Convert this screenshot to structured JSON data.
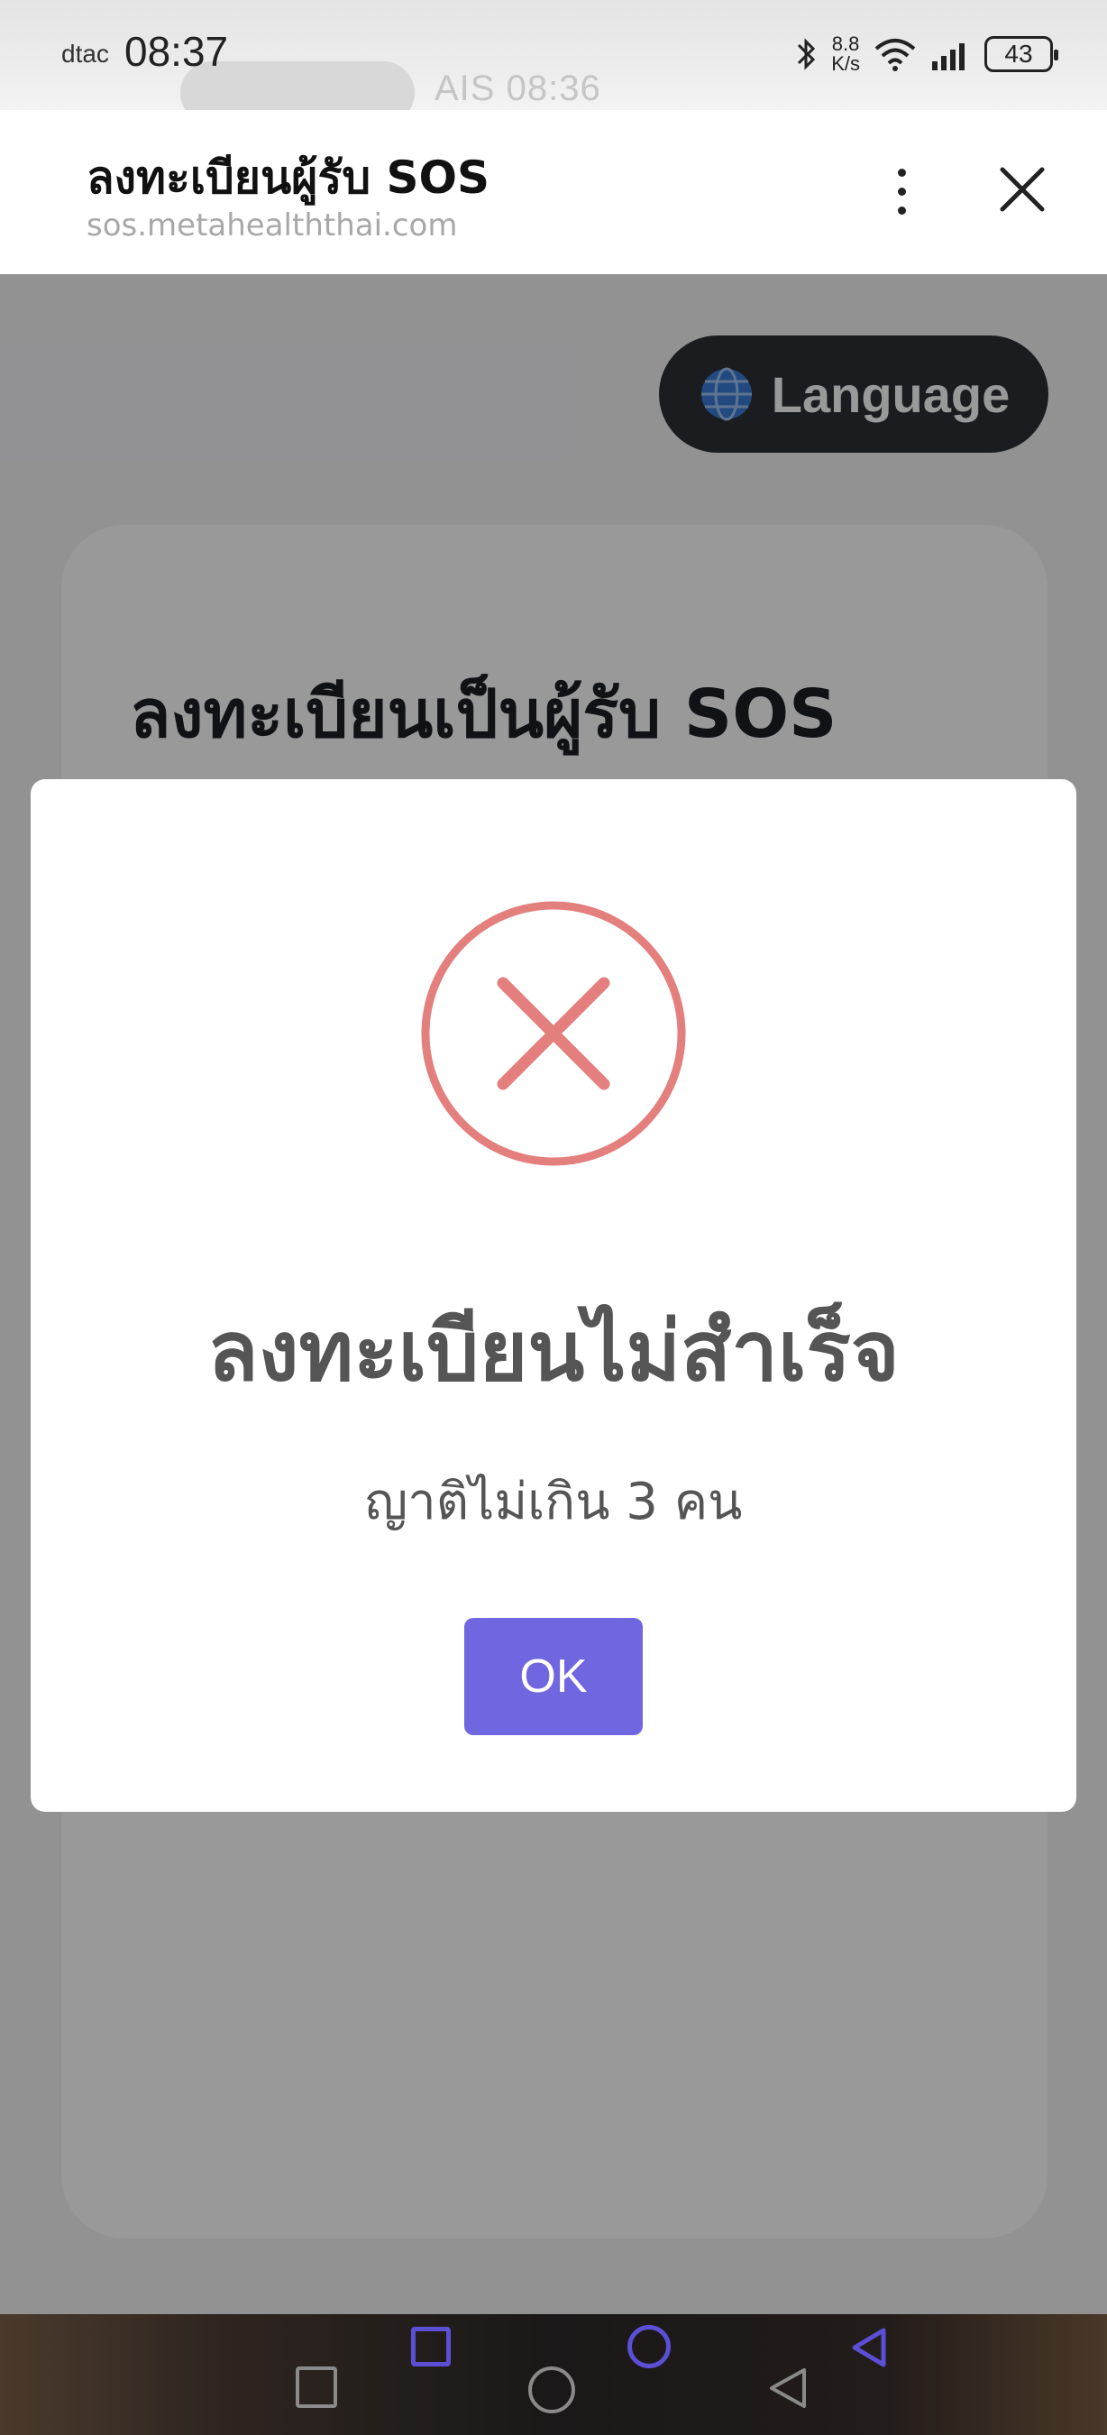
{
  "status_bar": {
    "carrier": "dtac",
    "time": "08:37",
    "ghost_carrier_time": "AIS 08:36",
    "net_speed_value": "8.8",
    "net_speed_unit": "K/s",
    "battery": "43"
  },
  "browser": {
    "title": "ลงทะเบียนผู้รับ SOS",
    "url": "sos.metahealththai.com",
    "menu_icon": "more-vert-icon",
    "close_icon": "close-icon"
  },
  "page": {
    "language_button": "Language",
    "form_title": "ลงทะเบียนเป็นผู้รับ SOS"
  },
  "modal": {
    "icon": "error-x-icon",
    "title": "ลงทะเบียนไม่สำเร็จ",
    "message": "ญาติไม่เกิน 3 คน",
    "ok_label": "OK"
  },
  "colors": {
    "error_red": "#e37f7d",
    "ok_button": "#7066e0",
    "language_button": "#2c2f36"
  }
}
